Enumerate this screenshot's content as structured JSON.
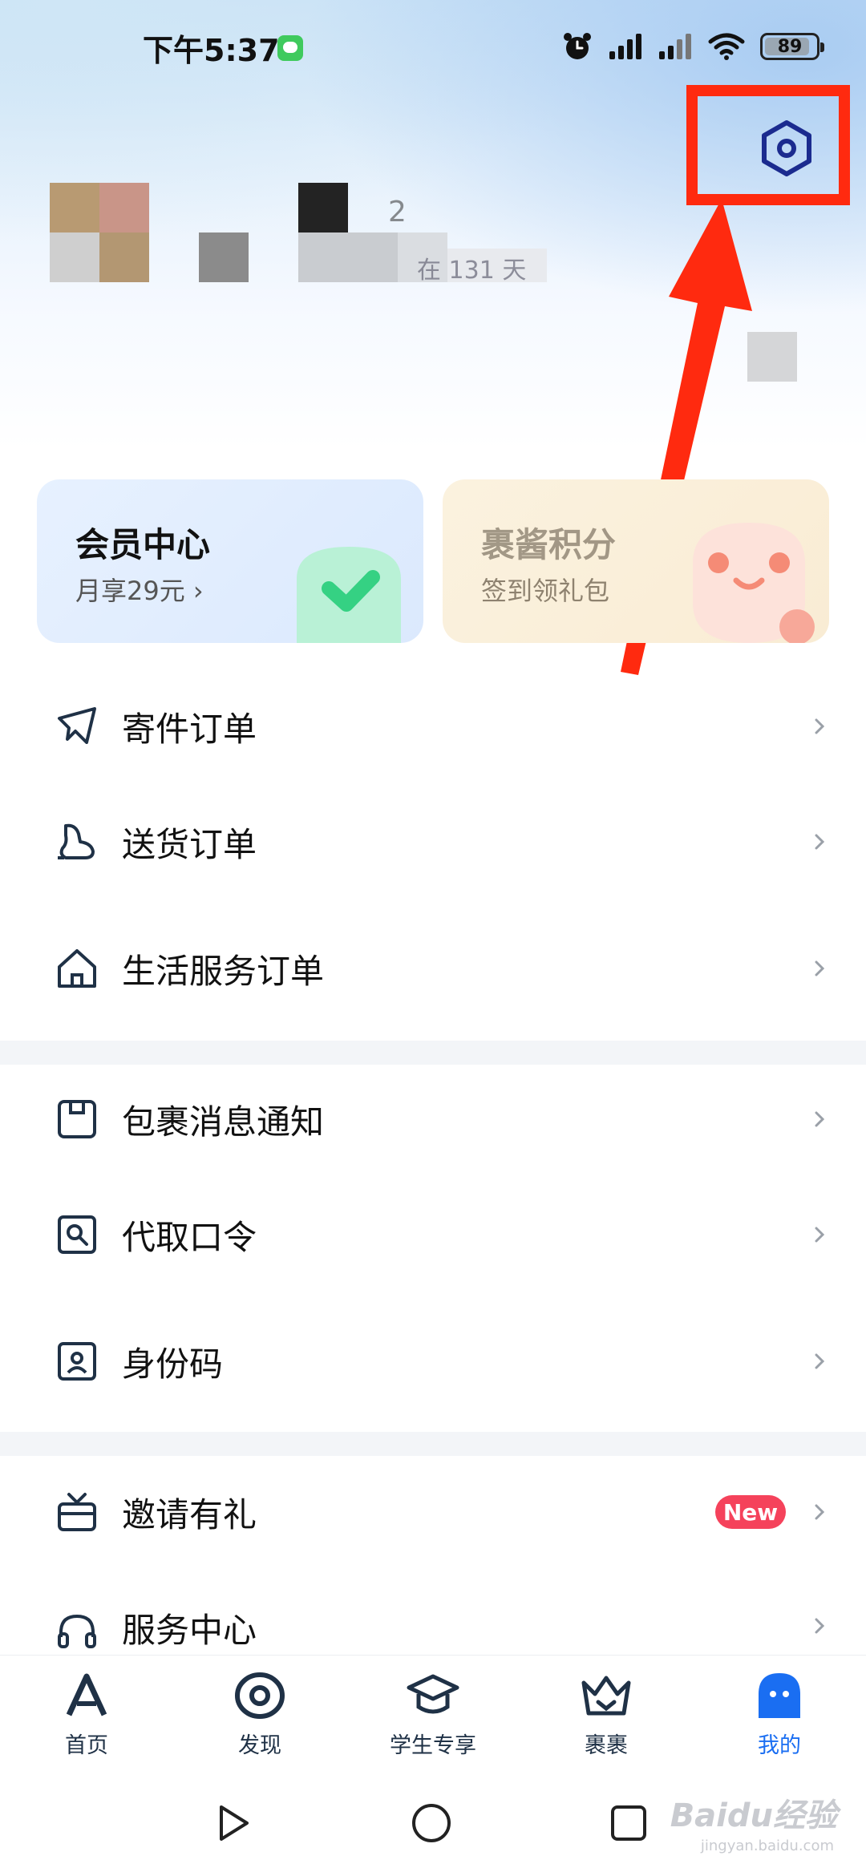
{
  "status_bar": {
    "time": "下午5:37",
    "battery_level": "89",
    "battery_fraction": 0.89
  },
  "settings": {
    "icon": "settings-icon"
  },
  "profile": {
    "name_fragment": "2",
    "days_text": "在 131 天"
  },
  "cards": {
    "member": {
      "title": "会员中心",
      "subtitle": "月享29元 ›"
    },
    "points": {
      "title": "裹酱积分",
      "subtitle": "签到领礼包"
    }
  },
  "menu": {
    "group1": [
      {
        "label": "寄件订单",
        "icon": "send-plane-icon"
      },
      {
        "label": "送货订单",
        "icon": "delivery-icon"
      },
      {
        "label": "生活服务订单",
        "icon": "home-icon"
      }
    ],
    "group2": [
      {
        "label": "包裹消息通知",
        "icon": "package-notice-icon"
      },
      {
        "label": "代取口令",
        "icon": "pickup-code-icon"
      },
      {
        "label": "身份码",
        "icon": "id-code-icon"
      }
    ],
    "group3": [
      {
        "label": "邀请有礼",
        "icon": "gift-tv-icon",
        "badge": "New"
      },
      {
        "label": "服务中心",
        "icon": "headset-icon"
      }
    ]
  },
  "tabs": [
    {
      "label": "首页",
      "icon": "home-logo-icon",
      "active": false
    },
    {
      "label": "发现",
      "icon": "discover-icon",
      "active": false
    },
    {
      "label": "学生专享",
      "icon": "graduation-cap-icon",
      "active": false
    },
    {
      "label": "裹裹",
      "icon": "crown-icon",
      "active": false
    },
    {
      "label": "我的",
      "icon": "profile-icon",
      "active": true
    }
  ],
  "watermark": {
    "text": "Baidu经验",
    "url": "jingyan.baidu.com"
  },
  "colors": {
    "accent": "#1a6ef2",
    "annotation": "#ff2a0f",
    "badge": "#f5425b",
    "icon_dark": "#1f3146"
  }
}
